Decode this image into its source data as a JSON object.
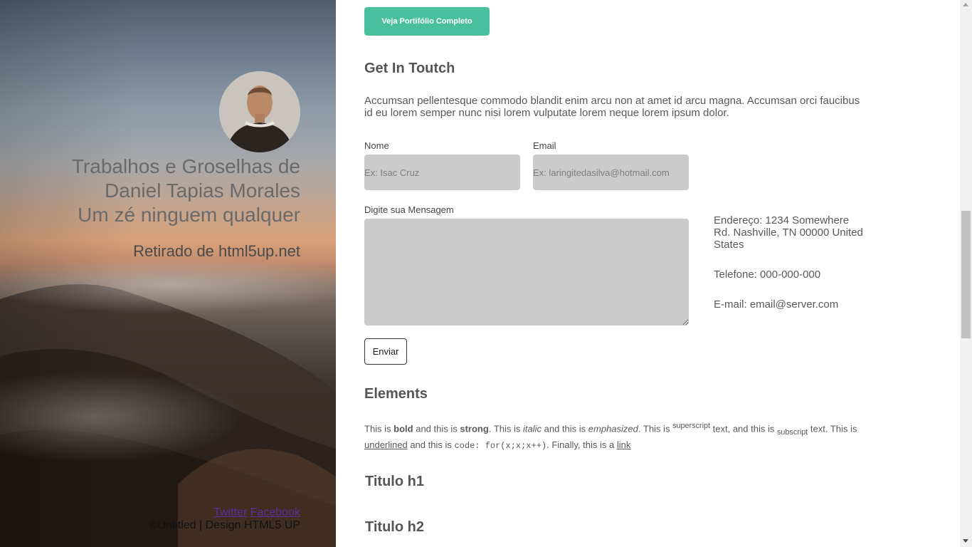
{
  "hero": {
    "title_lines": [
      "Trabalhos e Groselhas de",
      "Daniel Tapias Morales",
      "Um zé ninguem qualquer"
    ],
    "subtitle": "Retirado de html5up.net",
    "footer": {
      "twitter": "Twitter",
      "facebook": "Facebook",
      "copyright": "©Untitled | Design HTML5 UP"
    }
  },
  "portfolio_button": "Veja Portifólio Completo",
  "contact": {
    "heading": "Get In Toutch",
    "intro": "Accumsan pellentesque commodo blandit enim arcu non at amet id arcu magna. Accumsan orci faucibus id eu lorem semper nunc nisi lorem vulputate lorem neque lorem ipsum dolor.",
    "name_label": "Nome",
    "name_placeholder": "Ex: Isac Cruz",
    "email_label": "Email",
    "email_placeholder": "Ex: laringitedasilva@hotmail.com",
    "message_label": "Digite sua Mensagem",
    "send_button": "Enviar",
    "address": "Endereço: 1234 Somewhere Rd. Nashville, TN 00000 United States",
    "phone": "Telefone: 000-000-000",
    "email": "E-mail: email@server.com"
  },
  "elements": {
    "heading": "Elements",
    "t1": "This is ",
    "bold": "bold",
    "t2": " and this is ",
    "strong": "strong",
    "t3": ". This is ",
    "italic": "italic",
    "t4": " and this is ",
    "emphasized": "emphasized",
    "t5": ". This is ",
    "superscript": "superscript",
    "t6": " text, and this is ",
    "subscript": "subscript",
    "t7": " text. This is ",
    "underlined": "underlined",
    "t8": " and this is ",
    "code": "code: for(x;x;x++)",
    "t9": ". Finally, this is a ",
    "link": "link",
    "h1": "Titulo h1",
    "h2": "Titulo h2"
  },
  "colors": {
    "accent": "#49bf9d",
    "input_bg": "#cbcbcb",
    "link_visited": "#5a2fa0"
  }
}
